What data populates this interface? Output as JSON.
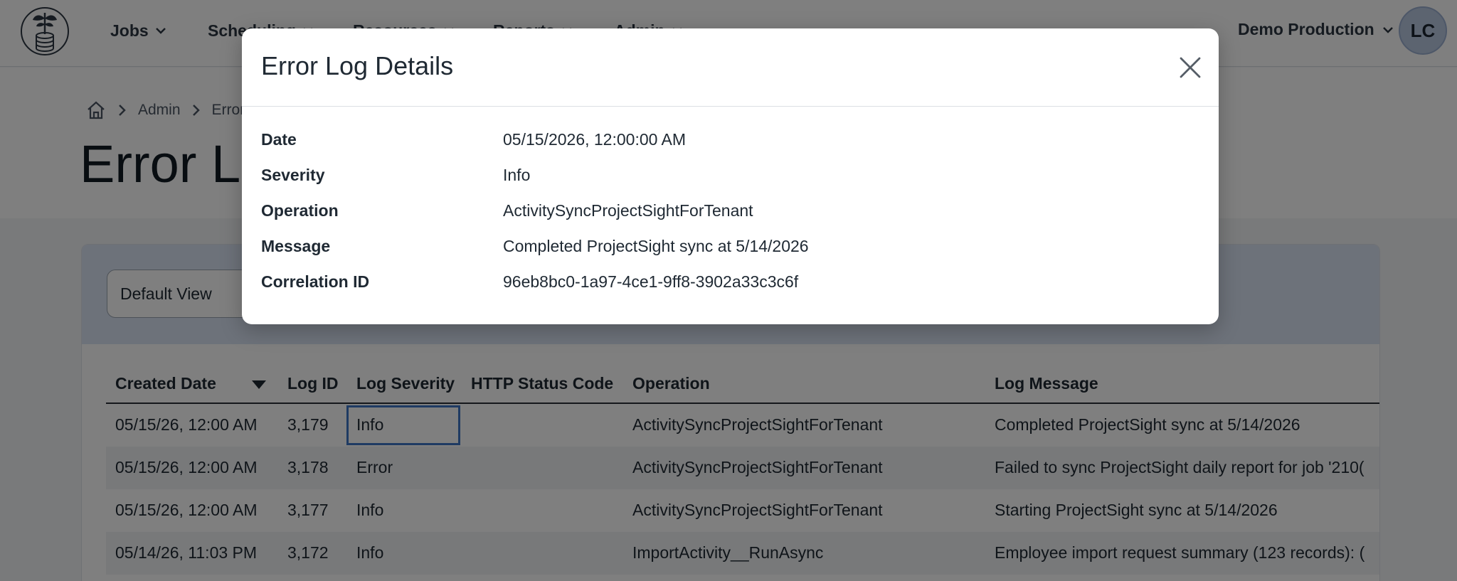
{
  "nav": {
    "items": [
      {
        "label": "Jobs"
      },
      {
        "label": "Scheduling"
      },
      {
        "label": "Resources"
      },
      {
        "label": "Reports"
      },
      {
        "label": "Admin"
      }
    ],
    "tenant": "Demo Production",
    "avatar_initials": "LC"
  },
  "breadcrumb": {
    "items": [
      {
        "label": "Admin"
      },
      {
        "label": "Error Log"
      }
    ]
  },
  "page": {
    "title": "Error Log"
  },
  "toolbar": {
    "view_select": "Default View"
  },
  "table": {
    "columns": [
      "Created Date",
      "Log ID",
      "Log Severity",
      "HTTP Status Code",
      "Operation",
      "Log Message"
    ],
    "sort": {
      "column": "Created Date",
      "direction": "descending"
    },
    "rows": [
      {
        "created": "05/15/26, 12:00 AM",
        "id": "3,179",
        "severity": "Info",
        "http": "",
        "operation": "ActivitySyncProjectSightForTenant",
        "message": "Completed ProjectSight sync at 5/14/2026"
      },
      {
        "created": "05/15/26, 12:00 AM",
        "id": "3,178",
        "severity": "Error",
        "http": "",
        "operation": "ActivitySyncProjectSightForTenant",
        "message": "Failed to sync ProjectSight daily report for job '210("
      },
      {
        "created": "05/15/26, 12:00 AM",
        "id": "3,177",
        "severity": "Info",
        "http": "",
        "operation": "ActivitySyncProjectSightForTenant",
        "message": "Starting ProjectSight sync at 5/14/2026"
      },
      {
        "created": "05/14/26, 11:03 PM",
        "id": "3,172",
        "severity": "Info",
        "http": "",
        "operation": "ImportActivity__RunAsync",
        "message": "Employee import request summary (123 records): ("
      }
    ]
  },
  "modal": {
    "title": "Error Log Details",
    "fields": [
      {
        "label": "Date",
        "value": "05/15/2026, 12:00:00 AM"
      },
      {
        "label": "Severity",
        "value": "Info"
      },
      {
        "label": "Operation",
        "value": "ActivitySyncProjectSightForTenant"
      },
      {
        "label": "Message",
        "value": "Completed ProjectSight sync at 5/14/2026"
      },
      {
        "label": "Correlation ID",
        "value": "96eb8bc0-1a97-4ce1-9ff8-3902a33c3c6f"
      }
    ]
  },
  "colors": {
    "overlay": "#000000",
    "focus_outline": "#3f77c6",
    "toolbar_band": "#dbe4f5",
    "avatar_bg": "#b9c8e0"
  },
  "icons": {
    "logo": "plant-coins-logo",
    "nav_chevron": "chevron-down-icon",
    "home": "home-icon",
    "breadcrumb_separator": "chevron-right-icon",
    "sort": "sort-descending-icon",
    "close": "close-icon"
  }
}
